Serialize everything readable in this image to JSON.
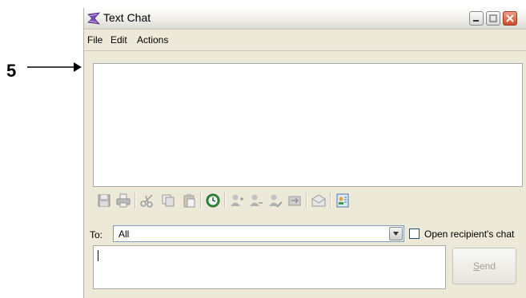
{
  "callout": {
    "number": "5"
  },
  "window": {
    "title": "Text Chat",
    "icon": "text-chat-app-icon",
    "controls": [
      "minimize-icon",
      "maximize-icon",
      "close-icon"
    ]
  },
  "menu": {
    "file": "File",
    "edit": "Edit",
    "actions": "Actions"
  },
  "toolbar": {
    "icons": [
      "save-icon",
      "print-icon",
      "cut-icon",
      "copy-icon",
      "paste-icon",
      "clock-icon",
      "user-add-icon",
      "user-remove-icon",
      "user-edit-icon",
      "transfer-icon",
      "envelope-icon",
      "contacts-icon"
    ]
  },
  "recipient": {
    "label": "To:",
    "selected": "All",
    "open_chat_label": "Open recipient's chat",
    "open_chat_checked": false
  },
  "compose": {
    "value": "",
    "send_prefix": "",
    "send_mnemonic": "S",
    "send_rest": "end"
  },
  "colors": {
    "window_bg": "#ece9d8",
    "close_button": "#cf4a2c",
    "clock_icon": "#2f8f3a",
    "disabled_text": "#a2a090"
  }
}
